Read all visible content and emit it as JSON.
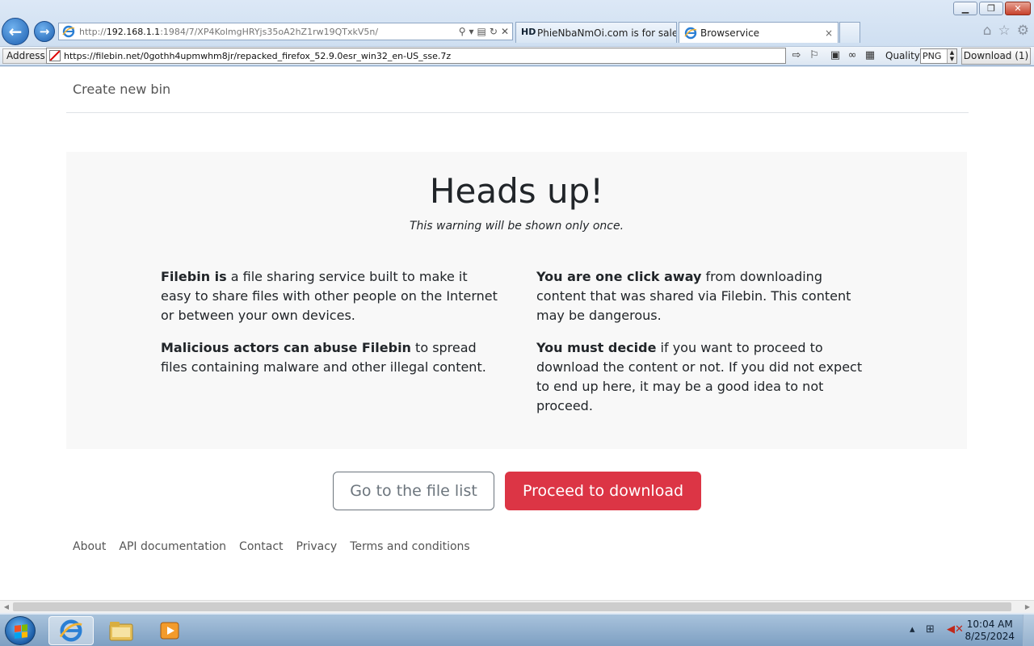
{
  "browser": {
    "url_prefix": "http://",
    "url_host": "192.168.1.1",
    "url_rest": ":1984/7/XP4KolmgHRYjs35oA2hZ1rw19QTxkV5n/",
    "tabs": [
      {
        "label": "PhieNbaNmOi.com is for sale ...",
        "favicon": "hd-icon",
        "active": false
      },
      {
        "label": "Browservice",
        "favicon": "ie-icon",
        "active": true
      }
    ],
    "close_tab_glyph": "×"
  },
  "address_row": {
    "label": "Address",
    "value": "https://filebin.net/0gothh4upmwhm8jr/repacked_firefox_52.9.0esr_win32_en-US_sse.7z",
    "quality_label": "Quality",
    "quality_value": "PNG",
    "download_label": "Download (1)"
  },
  "page": {
    "nav_link": "Create new bin",
    "title": "Heads up!",
    "subtitle": "This warning will be shown only once.",
    "left_col": [
      {
        "bold": "Filebin is",
        "text": " a file sharing service built to make it easy to share files with other people on the Internet or between your own devices."
      },
      {
        "bold": "Malicious actors can abuse Filebin",
        "text": " to spread files containing malware and other illegal content."
      }
    ],
    "right_col": [
      {
        "bold": "You are one click away",
        "text": " from downloading content that was shared via Filebin. This content may be dangerous."
      },
      {
        "bold": "You must decide",
        "text": " if you want to proceed to download the content or not. If you did not expect to end up here, it may be a good idea to not proceed."
      }
    ],
    "btn_file_list": "Go to the file list",
    "btn_proceed": "Proceed to download",
    "footer_links": [
      "About",
      "API documentation",
      "Contact",
      "Privacy",
      "Terms and conditions"
    ],
    "colors": {
      "danger": "#dc3545",
      "secondary": "#6c757d"
    }
  },
  "taskbar": {
    "time": "10:04 AM",
    "date": "8/25/2024"
  }
}
